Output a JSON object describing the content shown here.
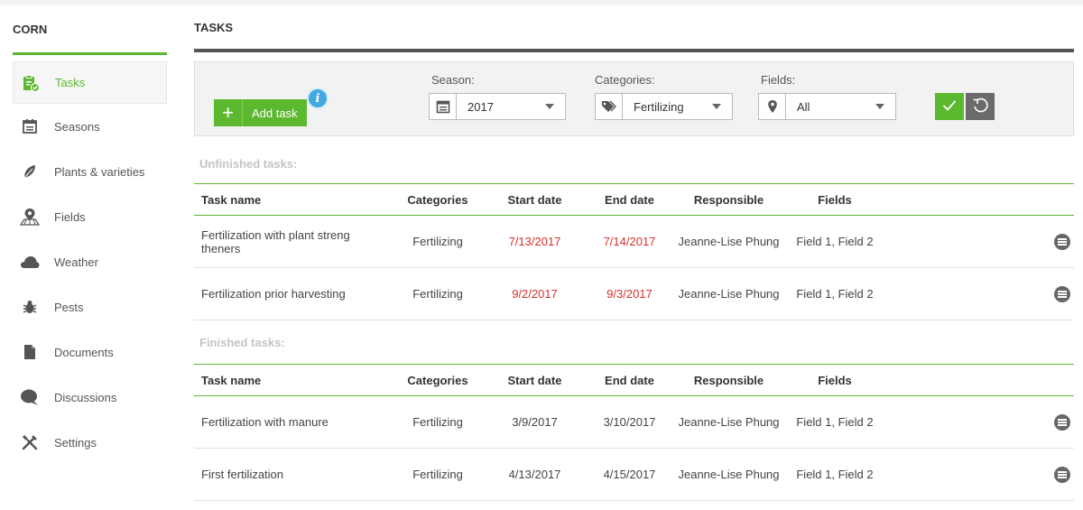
{
  "sidebar": {
    "title": "CORN",
    "items": [
      {
        "label": "Tasks",
        "icon": "clipboard-check-icon",
        "active": true
      },
      {
        "label": "Seasons",
        "icon": "calendar-icon"
      },
      {
        "label": "Plants & varieties",
        "icon": "leaf-icon"
      },
      {
        "label": "Fields",
        "icon": "map-pin-icon"
      },
      {
        "label": "Weather",
        "icon": "cloud-icon"
      },
      {
        "label": "Pests",
        "icon": "bug-icon"
      },
      {
        "label": "Documents",
        "icon": "document-icon"
      },
      {
        "label": "Discussions",
        "icon": "chat-bubble-icon"
      },
      {
        "label": "Settings",
        "icon": "tools-icon"
      }
    ]
  },
  "main": {
    "title": "TASKS"
  },
  "toolbar": {
    "add_task_label": "Add task",
    "info_glyph": "i",
    "season_label": "Season:",
    "season_value": "2017",
    "categories_label": "Categories:",
    "categories_value": "Fertilizing",
    "fields_label": "Fields:",
    "fields_value": "All"
  },
  "columns": [
    "Task name",
    "Categories",
    "Start date",
    "End date",
    "Responsible",
    "Fields"
  ],
  "unfinished": {
    "title": "Unfinished tasks:",
    "rows": [
      {
        "name": "Fertilization with plant streng theners",
        "category": "Fertilizing",
        "start": "7/13/2017",
        "end": "7/14/2017",
        "responsible": "Jeanne-Lise Phung",
        "fields": "Field 1, Field 2",
        "overdue": true
      },
      {
        "name": "Fertilization prior harvesting",
        "category": "Fertilizing",
        "start": "9/2/2017",
        "end": "9/3/2017",
        "responsible": "Jeanne-Lise Phung",
        "fields": "Field 1, Field 2",
        "overdue": true
      }
    ]
  },
  "finished": {
    "title": "Finished tasks:",
    "rows": [
      {
        "name": "Fertilization with manure",
        "category": "Fertilizing",
        "start": "3/9/2017",
        "end": "3/10/2017",
        "responsible": "Jeanne-Lise Phung",
        "fields": "Field 1, Field 2",
        "overdue": false
      },
      {
        "name": "First fertilization",
        "category": "Fertilizing",
        "start": "4/13/2017",
        "end": "4/15/2017",
        "responsible": "Jeanne-Lise Phung",
        "fields": "Field 1, Field 2",
        "overdue": false
      }
    ]
  },
  "colors": {
    "accent": "#5cb82e",
    "overdue": "#d9302b",
    "info": "#3fa9e0"
  }
}
